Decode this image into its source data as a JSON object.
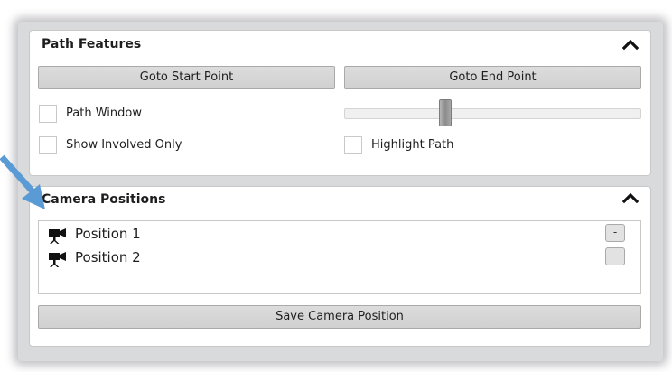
{
  "path_features": {
    "title": "Path Features",
    "goto_start_label": "Goto Start Point",
    "goto_end_label": "Goto End Point",
    "path_window_label": "Path Window",
    "path_window_checked": false,
    "show_involved_label": "Show Involved Only",
    "show_involved_checked": false,
    "highlight_path_label": "Highlight Path",
    "highlight_path_checked": false,
    "slider_value": 0.34,
    "collapse_icon": "chevron-up-icon"
  },
  "camera_positions": {
    "title": "Camera Positions",
    "collapse_icon": "chevron-up-icon",
    "positions": [
      {
        "label": "Position 1",
        "icon": "video-camera-icon",
        "remove_label": "-"
      },
      {
        "label": "Position 2",
        "icon": "video-camera-icon",
        "remove_label": "-"
      }
    ],
    "save_label": "Save Camera Position"
  },
  "colors": {
    "annotation_arrow": "#5b9bd5",
    "button_bg": "#d6d6d6",
    "panel_border": "#c8c8c8"
  }
}
